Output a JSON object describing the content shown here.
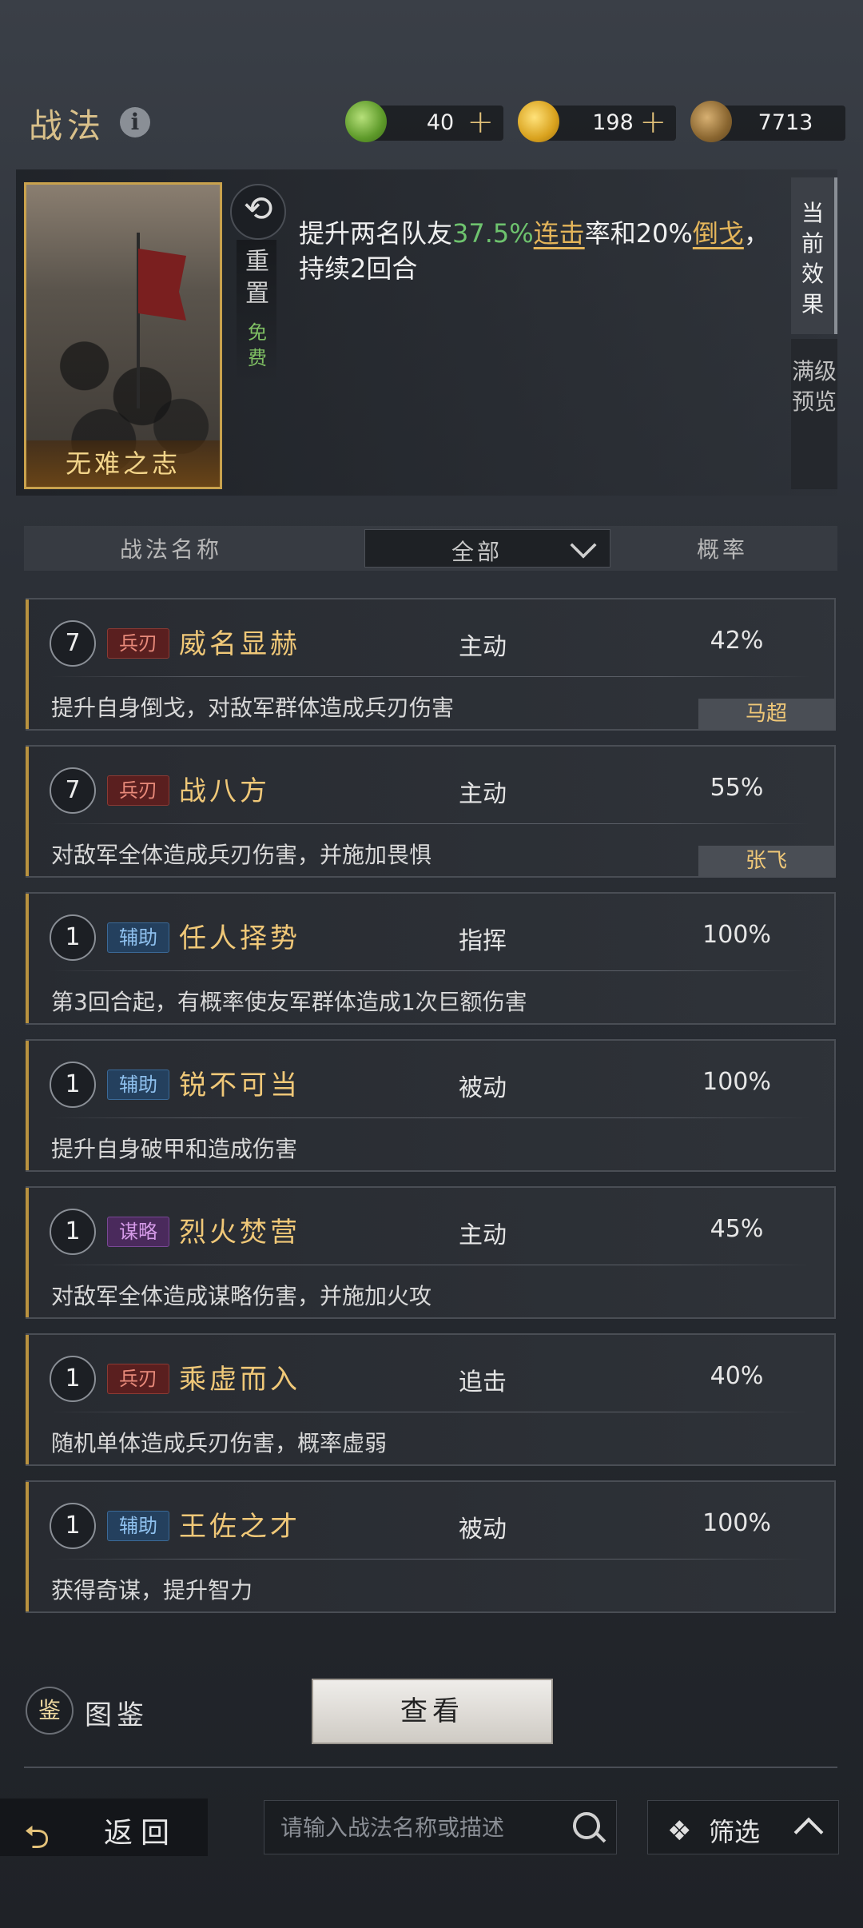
{
  "header": {
    "title": "战法",
    "info_icon": "i",
    "resources": [
      {
        "name": "jade-coin-icon",
        "value": "40",
        "color": "#7fbf3f"
      },
      {
        "name": "gold-coin-icon",
        "value": "198",
        "color": "#e6b82e"
      },
      {
        "name": "copper-coin-icon",
        "value": "7713",
        "color": "#a07a3e"
      }
    ],
    "plus": "+"
  },
  "current": {
    "card_name": "无难之志",
    "reset_label": "重置",
    "free_label": "免费",
    "effect_parts": {
      "p1": "提升两名队友",
      "g1": "37.5%",
      "u1": "连击",
      "p2": "率和20%",
      "u2": "倒戈",
      "p3": "，持续2回合"
    },
    "tabs": {
      "current": "当前效果",
      "max": "满级预览"
    }
  },
  "table_header": {
    "name": "战法名称",
    "filter": "全部",
    "rate": "概率"
  },
  "skills": [
    {
      "level": "7",
      "tag": "兵刃",
      "tag_type": "blade",
      "name": "威名显赫",
      "type": "主动",
      "rate": "42%",
      "desc": "提升自身倒戈，对敌军群体造成兵刃伤害",
      "hero": "马超"
    },
    {
      "level": "7",
      "tag": "兵刃",
      "tag_type": "blade",
      "name": "战八方",
      "type": "主动",
      "rate": "55%",
      "desc": "对敌军全体造成兵刃伤害，并施加畏惧",
      "hero": "张飞"
    },
    {
      "level": "1",
      "tag": "辅助",
      "tag_type": "assist",
      "name": "任人择势",
      "type": "指挥",
      "rate": "100%",
      "desc": "第3回合起，有概率使友军群体造成1次巨额伤害",
      "hero": ""
    },
    {
      "level": "1",
      "tag": "辅助",
      "tag_type": "assist",
      "name": "锐不可当",
      "type": "被动",
      "rate": "100%",
      "desc": "提升自身破甲和造成伤害",
      "hero": ""
    },
    {
      "level": "1",
      "tag": "谋略",
      "tag_type": "plan",
      "name": "烈火焚营",
      "type": "主动",
      "rate": "45%",
      "desc": "对敌军全体造成谋略伤害，并施加火攻",
      "hero": ""
    },
    {
      "level": "1",
      "tag": "兵刃",
      "tag_type": "blade",
      "name": "乘虚而入",
      "type": "追击",
      "rate": "40%",
      "desc": "随机单体造成兵刃伤害，概率虚弱",
      "hero": ""
    },
    {
      "level": "1",
      "tag": "辅助",
      "tag_type": "assist",
      "name": "王佐之才",
      "type": "被动",
      "rate": "100%",
      "desc": "获得奇谋，提升智力",
      "hero": ""
    }
  ],
  "bottom": {
    "guide_icon": "鉴",
    "guide_label": "图鉴",
    "view_button": "查看",
    "back_label": "返回",
    "search_placeholder": "请输入战法名称或描述",
    "filter_label": "筛选"
  }
}
